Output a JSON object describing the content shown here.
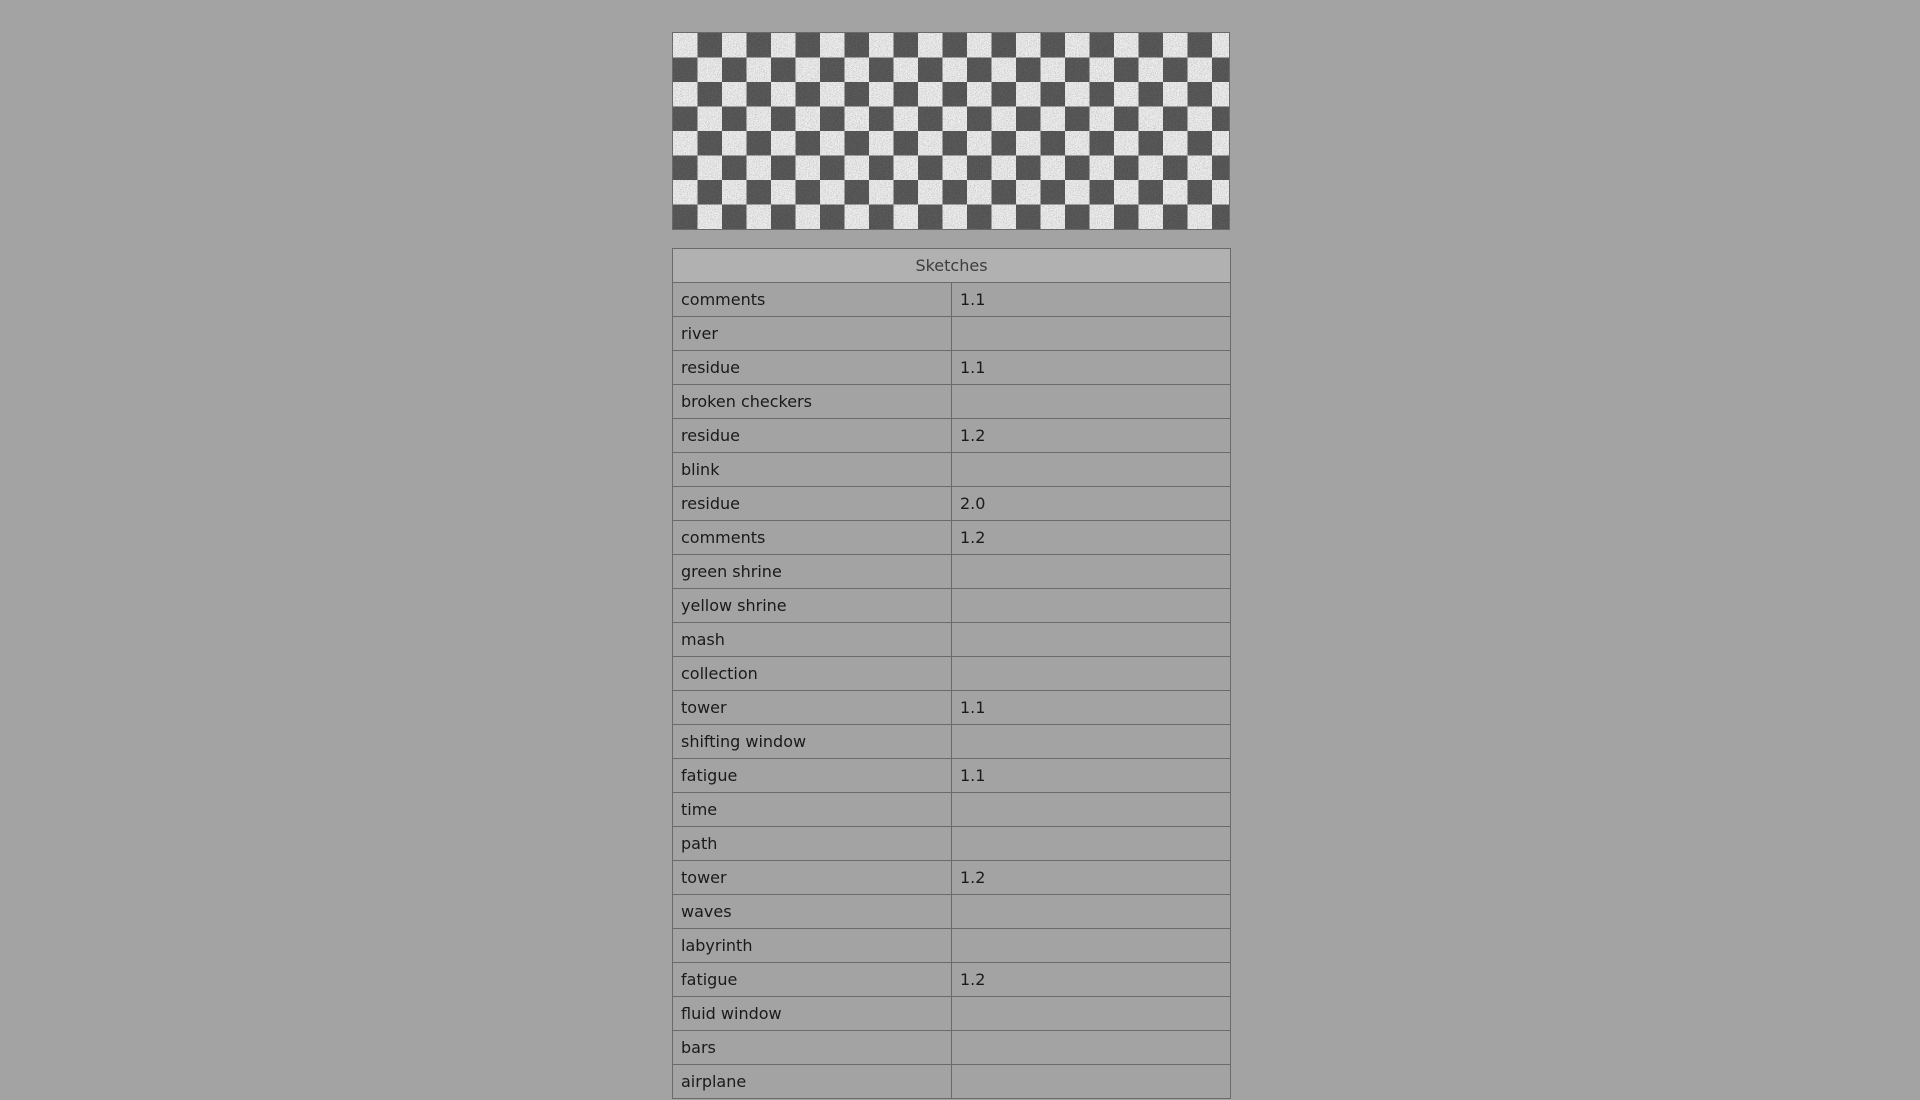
{
  "banner": {
    "name": "noise-checker-banner",
    "light_color": "#f2f2f2",
    "dark_color": "#5c5c5c"
  },
  "table": {
    "title": "Sketches",
    "rows": [
      {
        "name": "comments",
        "version": "1.1"
      },
      {
        "name": "river",
        "version": ""
      },
      {
        "name": "residue",
        "version": "1.1"
      },
      {
        "name": "broken checkers",
        "version": ""
      },
      {
        "name": "residue",
        "version": "1.2"
      },
      {
        "name": "blink",
        "version": ""
      },
      {
        "name": "residue",
        "version": "2.0"
      },
      {
        "name": "comments",
        "version": "1.2"
      },
      {
        "name": "green shrine",
        "version": ""
      },
      {
        "name": "yellow shrine",
        "version": ""
      },
      {
        "name": "mash",
        "version": ""
      },
      {
        "name": "collection",
        "version": ""
      },
      {
        "name": "tower",
        "version": "1.1"
      },
      {
        "name": "shifting window",
        "version": ""
      },
      {
        "name": "fatigue",
        "version": "1.1"
      },
      {
        "name": "time",
        "version": ""
      },
      {
        "name": "path",
        "version": ""
      },
      {
        "name": "tower",
        "version": "1.2"
      },
      {
        "name": "waves",
        "version": ""
      },
      {
        "name": "labyrinth",
        "version": ""
      },
      {
        "name": "fatigue",
        "version": "1.2"
      },
      {
        "name": "fluid window",
        "version": ""
      },
      {
        "name": "bars",
        "version": ""
      },
      {
        "name": "airplane",
        "version": ""
      }
    ]
  }
}
